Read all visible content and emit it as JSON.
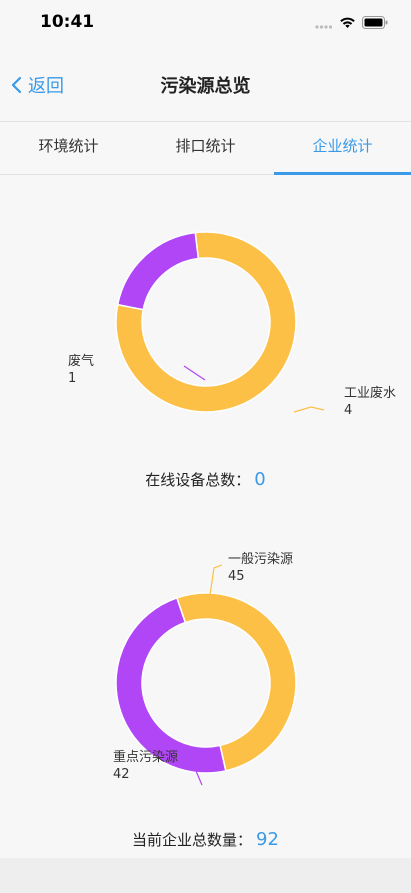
{
  "status": {
    "time": "10:41"
  },
  "nav": {
    "back_label": "返回",
    "title": "污染源总览"
  },
  "tabs": [
    {
      "label": "环境统计",
      "active": false
    },
    {
      "label": "排口统计",
      "active": false
    },
    {
      "label": "企业统计",
      "active": true
    }
  ],
  "colors": {
    "accent": "#3a9ae8",
    "yellow": "#fdc046",
    "purple": "#b146f7"
  },
  "chart_data": [
    {
      "type": "pie",
      "variant": "donut",
      "slices": [
        {
          "label": "工业废水",
          "value": 4,
          "color": "#fdc046"
        },
        {
          "label": "废气",
          "value": 1,
          "color": "#b146f7"
        }
      ]
    },
    {
      "type": "pie",
      "variant": "donut",
      "slices": [
        {
          "label": "一般污染源",
          "value": 45,
          "color": "#fdc046"
        },
        {
          "label": "重点污染源",
          "value": 42,
          "color": "#b146f7"
        }
      ]
    }
  ],
  "summary1": {
    "label": "在线设备总数：",
    "value": "0"
  },
  "summary2": {
    "label": "当前企业总数量：",
    "value": "92"
  }
}
